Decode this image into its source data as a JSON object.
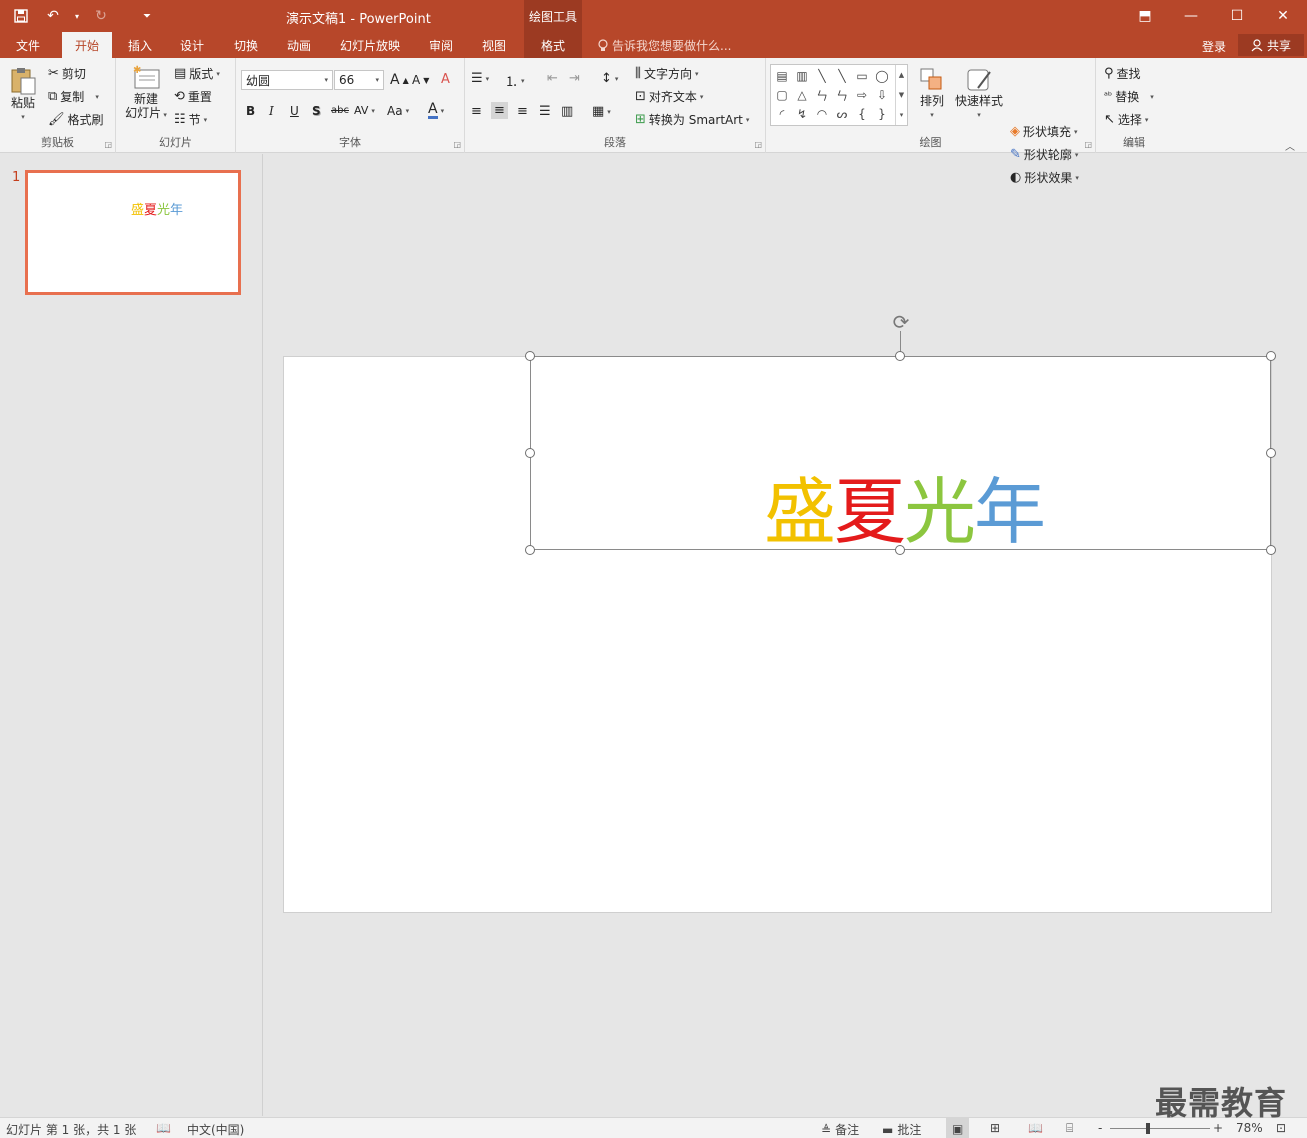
{
  "window": {
    "title": "演示文稿1 - PowerPoint",
    "context_header": "绘图工具",
    "quick_access": [
      {
        "name": "save",
        "glyph": "💾"
      },
      {
        "name": "undo",
        "glyph": "↶"
      },
      {
        "name": "undo-dropdown",
        "glyph": "▾"
      },
      {
        "name": "redo",
        "glyph": "↻"
      },
      {
        "name": "customize",
        "glyph": "⏷"
      }
    ],
    "controls": {
      "ribbon_display": "⬒",
      "minimize": "—",
      "maximize": "☐",
      "close": "✕"
    }
  },
  "tabs": [
    {
      "label": "文件"
    },
    {
      "label": "开始"
    },
    {
      "label": "插入"
    },
    {
      "label": "设计"
    },
    {
      "label": "切换"
    },
    {
      "label": "动画"
    },
    {
      "label": "幻灯片放映"
    },
    {
      "label": "审阅"
    },
    {
      "label": "视图"
    },
    {
      "label": "格式"
    }
  ],
  "tell_me": "告诉我您想要做什么...",
  "login": "登录",
  "share": "共享",
  "ribbon": {
    "clipboard": {
      "label": "剪贴板",
      "paste": "粘贴",
      "cut": "剪切",
      "copy": "复制",
      "format_painter": "格式刷"
    },
    "slides": {
      "label": "幻灯片",
      "new_slide_1": "新建",
      "new_slide_2": "幻灯片",
      "layout": "版式",
      "reset": "重置",
      "section": "节"
    },
    "font": {
      "label": "字体",
      "font_name": "幼圆",
      "font_size": "66",
      "grow": "A",
      "shrink": "A",
      "clear": "A",
      "bold": "B",
      "italic": "I",
      "underline": "U",
      "shadow": "S",
      "strike": "abc",
      "spacing": "AV",
      "case": "Aa",
      "color": "A"
    },
    "paragraph": {
      "label": "段落",
      "text_direction": "文字方向",
      "align_text": "对齐文本",
      "smartart": "转换为 SmartArt"
    },
    "drawing": {
      "label": "绘图",
      "arrange": "排列",
      "quick_styles": "快速样式",
      "shape_fill": "形状填充",
      "shape_outline": "形状轮廓",
      "shape_effects": "形状效果",
      "shapes": [
        "▤",
        "▥",
        "╲",
        "╲",
        "▭",
        "◯",
        "▢",
        "△",
        "ㄣ",
        "ㄣ",
        "⇨",
        "⇩",
        "◜",
        "↯",
        "◠",
        "ᔕ",
        "{",
        "}"
      ]
    },
    "editing": {
      "label": "编辑",
      "find": "查找",
      "replace": "替换",
      "select": "选择"
    }
  },
  "thumbnails": [
    {
      "number": "1",
      "chars": [
        "盛",
        "夏",
        "光",
        "年"
      ]
    }
  ],
  "slide": {
    "chars": [
      {
        "text": "盛",
        "color": "#f2c100"
      },
      {
        "text": "夏",
        "color": "#e41b1b"
      },
      {
        "text": "光",
        "color": "#8cc63f"
      },
      {
        "text": "年",
        "color": "#5b9bd5"
      }
    ]
  },
  "status": {
    "slide_info": "幻灯片 第 1 张，共 1 张",
    "language": "中文(中国)",
    "notes": "备注",
    "comments": "批注",
    "zoom_minus": "-",
    "zoom_plus": "+",
    "zoom": "78%"
  },
  "watermark": "最需教育"
}
